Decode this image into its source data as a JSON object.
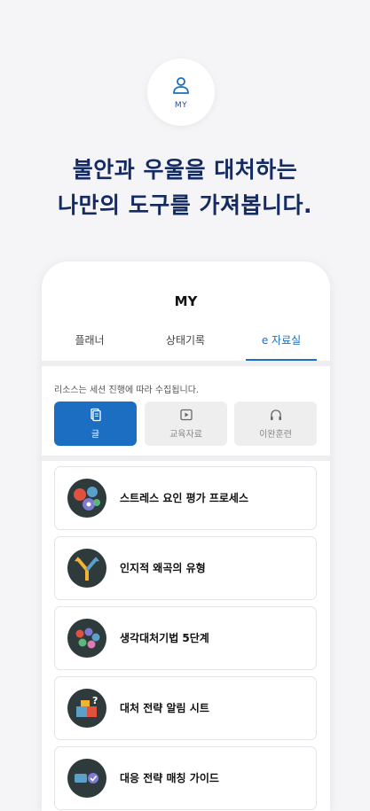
{
  "hero": {
    "my_label": "MY",
    "headline_line1": "불안과 우울을 대처하는",
    "headline_line2": "나만의 도구를 가져봅니다."
  },
  "screen": {
    "title": "MY",
    "tabs": [
      {
        "label": "플래너",
        "active": false
      },
      {
        "label": "상태기록",
        "active": false
      },
      {
        "label": "e 자료실",
        "active": true
      }
    ],
    "notice": "리소스는 세션 진행에 따라 수집됩니다.",
    "segments": [
      {
        "label": "글",
        "icon": "document-icon",
        "active": true
      },
      {
        "label": "교육자료",
        "icon": "video-icon",
        "active": false
      },
      {
        "label": "이완훈련",
        "icon": "headphones-icon",
        "active": false
      }
    ],
    "items": [
      {
        "label": "스트레스 요인 평가 프로세스",
        "icon": "gears-icon"
      },
      {
        "label": "인지적 왜곡의 유형",
        "icon": "fork-arrows-icon"
      },
      {
        "label": "생각대처기법 5단계",
        "icon": "dots-cluster-icon"
      },
      {
        "label": "대처 전략 알림 시트",
        "icon": "puzzle-question-icon"
      },
      {
        "label": "대응 전략 매칭 가이드",
        "icon": "matching-icon"
      }
    ]
  },
  "colors": {
    "accent": "#1b6ec2",
    "headline": "#142a63",
    "background": "#f5f5f7"
  }
}
